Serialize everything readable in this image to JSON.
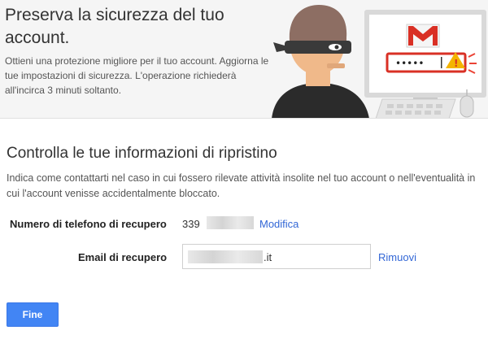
{
  "hero": {
    "title": "Preserva la sicurezza del tuo account.",
    "description": "Ottieni una protezione migliore per il tuo account. Aggiorna le tue impostazioni di sicurezza. L'operazione richiederà all'incirca 3 minuti soltanto.",
    "password_mask": "•••••",
    "illustration_icons": [
      "thief-icon",
      "monitor-icon",
      "gmail-icon",
      "password-field-icon",
      "warning-icon",
      "keyboard-icon",
      "mouse-icon"
    ]
  },
  "recovery": {
    "title": "Controlla le tue informazioni di ripristino",
    "description": "Indica come contattarti nel caso in cui fossero rilevate attività insolite nel tuo account o nell'eventualità in cui l'account venisse accidentalmente bloccato.",
    "phone": {
      "label": "Numero di telefono di recupero",
      "prefix": "339",
      "action": "Modifica"
    },
    "email": {
      "label": "Email di recupero",
      "suffix": ".it",
      "action": "Rimuovi"
    }
  },
  "footer": {
    "done_label": "Fine"
  },
  "colors": {
    "accent": "#4285f4",
    "link": "#3367d6",
    "gmail_red": "#d93025",
    "warning": "#ea4335",
    "hero_bg": "#f5f5f5"
  }
}
